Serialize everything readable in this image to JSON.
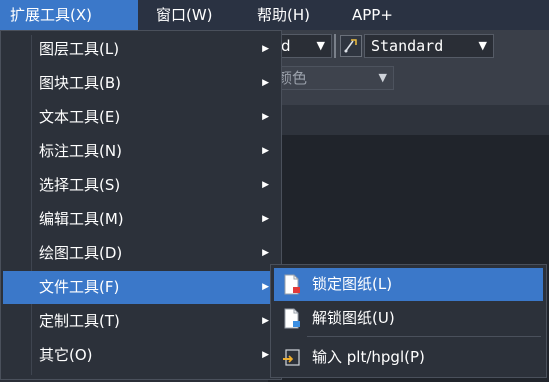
{
  "menubar": {
    "items": [
      {
        "label": "扩展工具(X)"
      },
      {
        "label": "窗口(W)"
      },
      {
        "label": "帮助(H)"
      },
      {
        "label": "APP+"
      }
    ]
  },
  "toolbar": {
    "linetype_value": "d",
    "style_value": "Standard",
    "color_placeholder": "颜色"
  },
  "dropdown": {
    "items": [
      {
        "label": "图层工具(L)"
      },
      {
        "label": "图块工具(B)"
      },
      {
        "label": "文本工具(E)"
      },
      {
        "label": "标注工具(N)"
      },
      {
        "label": "选择工具(S)"
      },
      {
        "label": "编辑工具(M)"
      },
      {
        "label": "绘图工具(D)"
      },
      {
        "label": "文件工具(F)"
      },
      {
        "label": "定制工具(T)"
      },
      {
        "label": "其它(O)"
      }
    ]
  },
  "submenu": {
    "items": [
      {
        "label": "锁定图纸(L)",
        "icon": "lock-drawing-icon"
      },
      {
        "label": "解锁图纸(U)",
        "icon": "unlock-drawing-icon"
      },
      {
        "label": "输入 plt/hpgl(P)",
        "icon": "import-plt-icon"
      }
    ]
  },
  "colors": {
    "accent": "#3b78c9",
    "menu_bg": "#2c313a",
    "menubar_bg": "#2a3242"
  }
}
